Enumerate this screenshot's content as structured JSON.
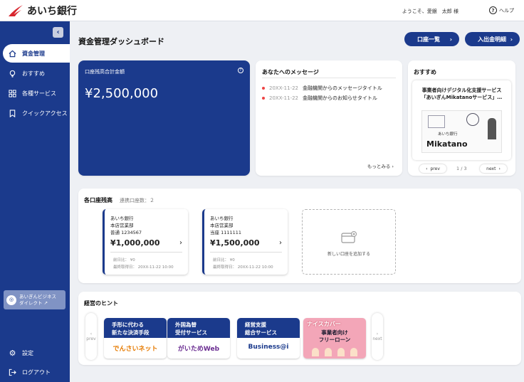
{
  "header": {
    "bank_name": "あいち銀行",
    "welcome": "ようこそ、愛銀　太郎 様",
    "help_label": "ヘルプ"
  },
  "sidebar": {
    "items": [
      {
        "label": "資金管理",
        "icon": "home-icon"
      },
      {
        "label": "おすすめ",
        "icon": "bulb-icon"
      },
      {
        "label": "各種サービス",
        "icon": "grid-icon"
      },
      {
        "label": "クイックアクセス",
        "icon": "bookmark-icon"
      }
    ],
    "direct_line1": "あいぎんビジネス",
    "direct_line2": "ダイレクト",
    "settings_label": "設定",
    "logout_label": "ログアウト"
  },
  "main": {
    "title": "資金管理ダッシュボード",
    "btn_accounts": "口座一覧",
    "btn_statement": "入出金明細"
  },
  "balance": {
    "label": "口座残高合計金額",
    "amount": "¥2,500,000"
  },
  "messages": {
    "title": "あなたへのメッセージ",
    "items": [
      {
        "date": "20XX-11-22",
        "text": "金融機関からのメッセージタイトル"
      },
      {
        "date": "20XX-11-22",
        "text": "金融機関からのお知らせタイトル"
      }
    ],
    "more": "もっとみる"
  },
  "recommend": {
    "title": "おすすめ",
    "line1": "事業者向けデジタル化支援サービス",
    "line2": "「あいぎんMikatanoサービス」…",
    "img_bank": "あいち銀行",
    "img_brand": "Mikatano",
    "prev": "prev",
    "next": "next",
    "page": "1 / 3"
  },
  "accounts": {
    "title": "各口座残高",
    "count": "連携口座数：２",
    "items": [
      {
        "bank": "あいち銀行",
        "branch": "本店営業部",
        "number": "普通 1234567",
        "amount": "¥1,000,000",
        "diff": "前日比： ¥0",
        "updated": "最終取得日： 20XX-11-22 10:00"
      },
      {
        "bank": "あいち銀行",
        "branch": "本店営業部",
        "number": "当座 1111111",
        "amount": "¥1,500,000",
        "diff": "前日比： ¥0",
        "updated": "最終取得日： 20XX-11-22 10:00"
      }
    ],
    "add_label": "新しい口座を追加する"
  },
  "hints": {
    "title": "経営のヒント",
    "prev": "prev",
    "next": "next",
    "tiles": [
      {
        "line1": "手形に代わる",
        "line2": "新たな決済手段",
        "logo": "でんさいネット"
      },
      {
        "line1": "外国為替",
        "line2": "受付サービス",
        "logo": "がいためWeb"
      },
      {
        "line1": "経営支援",
        "line2": "総合サービス",
        "logo": "Business@i"
      },
      {
        "line1": "ナイスカバー",
        "line2": "事業者向け",
        "line3": "フリーローン",
        "logo": ""
      }
    ]
  },
  "colors": {
    "primary": "#1b3a8c",
    "accent": "#e44444"
  }
}
